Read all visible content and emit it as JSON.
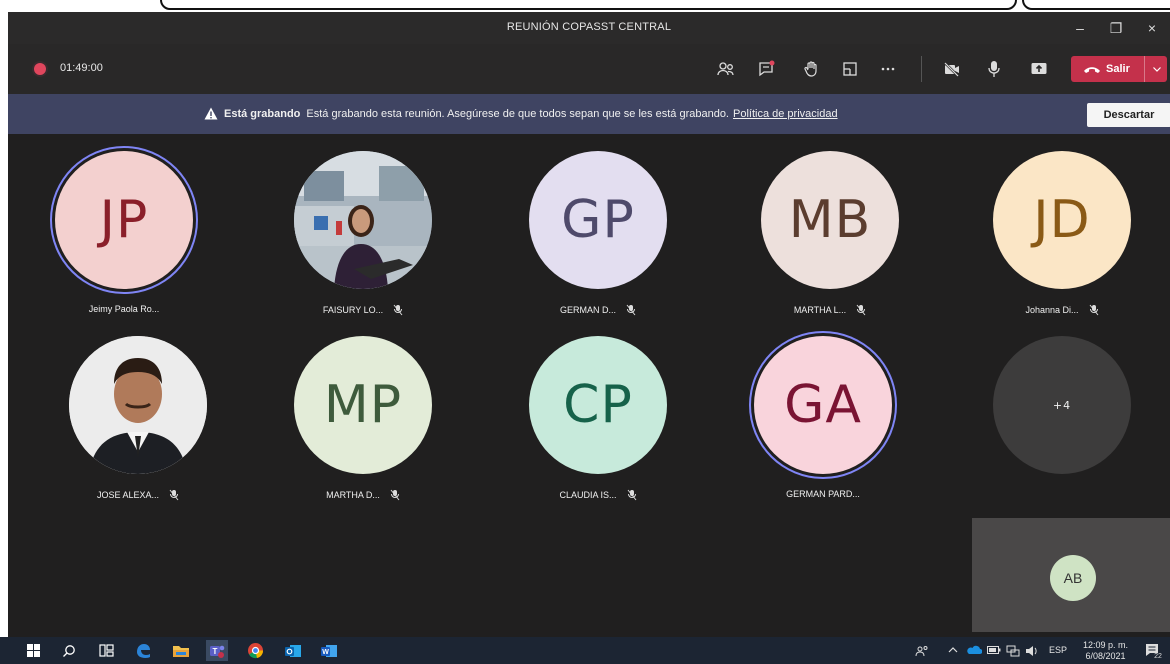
{
  "window": {
    "title": "REUNIÓN COPASST CENTRAL",
    "minimize": "–",
    "maximize": "❐",
    "close": "×"
  },
  "toolbar": {
    "timer": "01:49:00",
    "leave_label": "Salir",
    "icons": [
      "people-icon",
      "chat-icon",
      "raise-hand-icon",
      "rooms-icon",
      "more-icon",
      "camera-off-icon",
      "mic-icon",
      "share-icon"
    ]
  },
  "banner": {
    "title": "Está grabando",
    "message": "Está grabando esta reunión. Asegúrese de que todos sepan que se les está grabando.",
    "link": "Política de privacidad",
    "dismiss_label": "Descartar"
  },
  "colors": {
    "accent": "#7f85f5",
    "leave": "#c4314b",
    "banner": "#3f4462"
  },
  "participants": [
    {
      "initials": "JP",
      "name": "Jeimy Paola Ro...",
      "bg": "#f3d0cf",
      "fg": "#8a1f2a",
      "speaking": true,
      "muted": false
    },
    {
      "initials": "",
      "name": "FAISURY LO...",
      "photo": "woman-photo",
      "bg": "#8a97a3",
      "fg": "#000",
      "speaking": false,
      "muted": true
    },
    {
      "initials": "GP",
      "name": "GERMAN D...",
      "bg": "#e3def0",
      "fg": "#4f4a6b",
      "speaking": false,
      "muted": true
    },
    {
      "initials": "MB",
      "name": "MARTHA L...",
      "bg": "#ede0dc",
      "fg": "#5b3d2f",
      "speaking": false,
      "muted": true
    },
    {
      "initials": "JD",
      "name": "Johanna Di...",
      "bg": "#fbe6c6",
      "fg": "#8a5a16",
      "speaking": false,
      "muted": true
    },
    {
      "initials": "",
      "name": "JOSE ALEXA...",
      "photo": "man-photo",
      "bg": "#e6e6e6",
      "fg": "#000",
      "speaking": false,
      "muted": true
    },
    {
      "initials": "MP",
      "name": "MARTHA D...",
      "bg": "#e3ecd8",
      "fg": "#3e5b3c",
      "speaking": false,
      "muted": true
    },
    {
      "initials": "CP",
      "name": "CLAUDIA IS...",
      "bg": "#c7eadb",
      "fg": "#16624a",
      "speaking": false,
      "muted": true
    },
    {
      "initials": "GA",
      "name": "GERMAN PARD...",
      "bg": "#f9d4dc",
      "fg": "#7a1433",
      "speaking": true,
      "muted": false
    },
    {
      "initials": "+4",
      "name": "",
      "bg": "#3d3c3c",
      "fg": "#f0f0f0",
      "speaking": false,
      "muted": false
    }
  ],
  "self_view": {
    "initials": "AB"
  },
  "taskbar": {
    "apps": [
      "windows-start-icon",
      "search-icon",
      "task-view-icon",
      "edge-icon",
      "file-explorer-icon",
      "teams-icon",
      "chrome-icon",
      "outlook-icon",
      "word-icon"
    ],
    "tray_lang": "ESP",
    "time": "12:09 p. m.",
    "date": "6/08/2021",
    "badge": "22"
  }
}
